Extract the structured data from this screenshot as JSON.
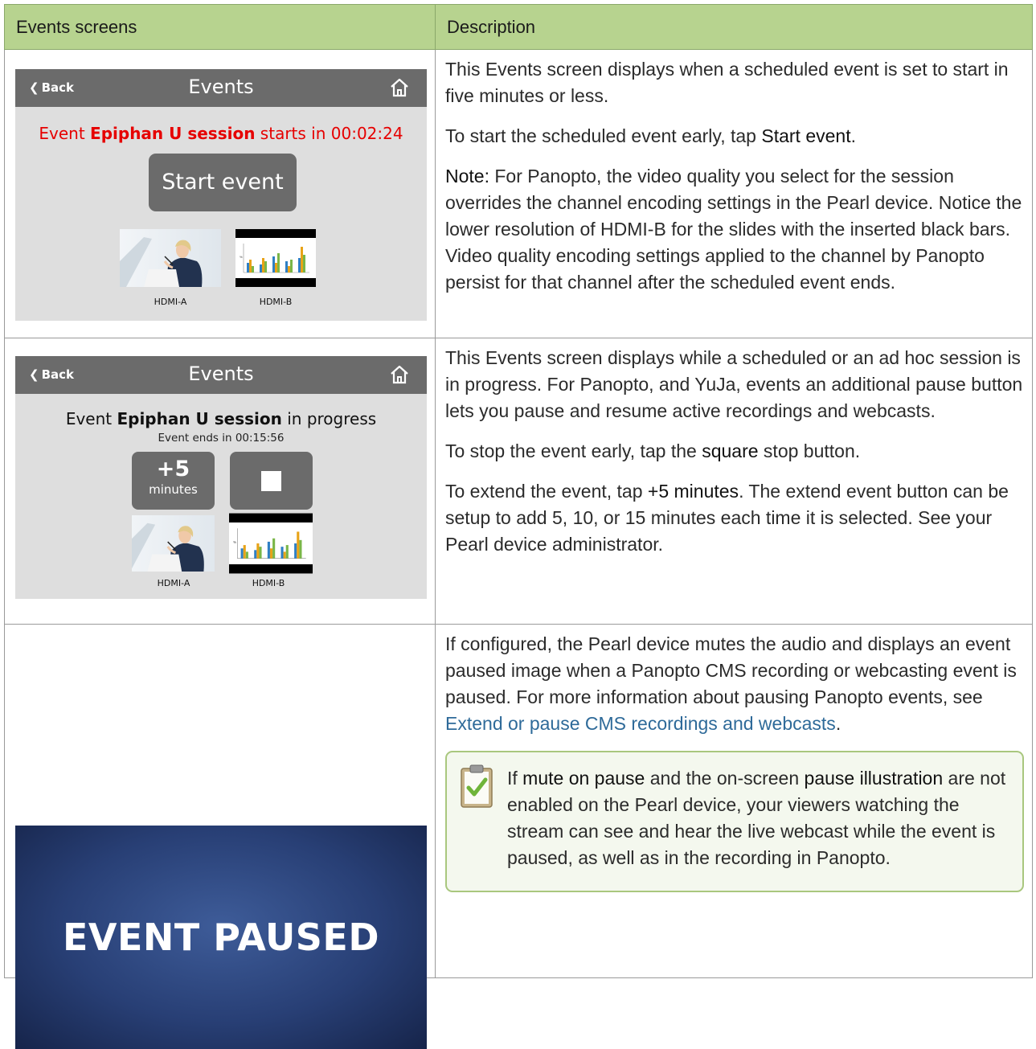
{
  "table": {
    "headers": [
      "Events screens",
      "Description"
    ]
  },
  "screen1": {
    "back_label": "Back",
    "title": "Events",
    "status_prefix": "Event ",
    "event_name": "Epiphan U session",
    "status_suffix": " starts in 00:02:24",
    "start_button": "Start event",
    "thumb_a_label": "HDMI-A",
    "thumb_b_label": "HDMI-B"
  },
  "screen2": {
    "back_label": "Back",
    "title": "Events",
    "status_prefix": "Event ",
    "event_name": "Epiphan U session",
    "status_suffix": " in progress",
    "ends_in": "Event ends in 00:15:56",
    "extend_big": "+5",
    "extend_small": "minutes",
    "thumb_a_label": "HDMI-A",
    "thumb_b_label": "HDMI-B"
  },
  "screen3": {
    "paused_text": "EVENT PAUSED"
  },
  "row1": {
    "p1": "This Events screen displays when a scheduled event is set to start in five minutes or less.",
    "p2_pre": "To start the scheduled event early, tap ",
    "p2_bold": "Start event",
    "p2_post": ".",
    "p3_bold": "Note:",
    "p3_text": " For Panopto, the video quality you select for the session overrides the channel encoding settings in the Pearl device. Notice the lower resolution of HDMI-B for the slides with the inserted black bars. Video quality encoding settings applied to the channel by Panopto persist for that channel after the scheduled event ends."
  },
  "row2": {
    "p1": "This Events screen displays while a scheduled or an ad hoc session is in progress. For Panopto, and YuJa, events an additional pause button lets you pause and resume active recordings and webcasts.",
    "p2_pre": "To stop the event early, tap the ",
    "p2_bold": "square",
    "p2_post": " stop button.",
    "p3_pre": "To extend the event, tap ",
    "p3_bold": "+5 minutes",
    "p3_post": ". The extend event button can be setup to add 5, 10, or 15 minutes each time it is selected. See your Pearl device administrator."
  },
  "row3": {
    "p1_text": "If configured, the Pearl device mutes the audio and displays an event paused image when a Panopto CMS recording or webcasting event is paused. For more information about pausing Panopto events, see ",
    "p1_link": "Extend or pause CMS recordings and webcasts",
    "p1_end": ".",
    "note_pre": "If ",
    "note_b1": "mute on pause",
    "note_mid": " and the on-screen ",
    "note_b2": "pause illustration",
    "note_post": " are not enabled on the Pearl device, your viewers watching the stream can see and hear the live webcast while the event is paused, as well as in the recording in Panopto."
  }
}
